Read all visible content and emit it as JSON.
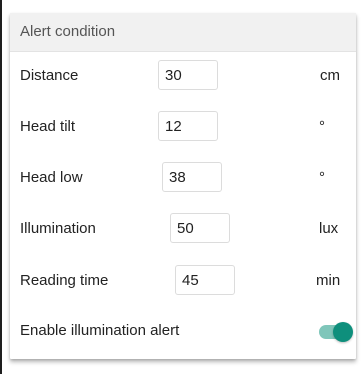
{
  "panel": {
    "title": "Alert condition"
  },
  "rows": [
    {
      "label": "Distance",
      "value": "30",
      "unit": "cm"
    },
    {
      "label": "Head tilt",
      "value": "12",
      "unit": "°"
    },
    {
      "label": "Head low",
      "value": "38",
      "unit": "°"
    },
    {
      "label": "Illumination",
      "value": "50",
      "unit": "lux"
    },
    {
      "label": "Reading time",
      "value": "45",
      "unit": "min"
    }
  ],
  "toggle": {
    "label": "Enable illumination alert",
    "on": true,
    "color": "#0e8f7c"
  }
}
